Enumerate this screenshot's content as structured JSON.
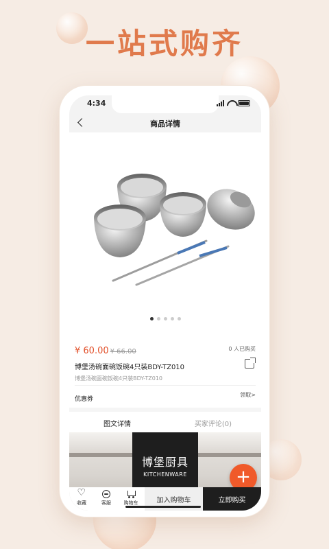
{
  "hero": {
    "title": "一站式购齐"
  },
  "status": {
    "time": "4:34"
  },
  "nav": {
    "title": "商品详情"
  },
  "carousel": {
    "count": 5,
    "active_index": 0
  },
  "product": {
    "price": "¥ 60.00",
    "original_price": "¥ 66.00",
    "buyers": "0 人已购买",
    "name": "博堡汤碗面碗饭碗4只装BDY-TZ010",
    "subtitle": "博堡汤碗面碗饭碗4只装BDY-TZ010"
  },
  "coupon": {
    "label": "优惠券",
    "action": "领取>"
  },
  "tabs": [
    {
      "label": "图文详情",
      "active": true
    },
    {
      "label": "买家评论(0)",
      "active": false
    }
  ],
  "banner": {
    "brand_cn": "博堡厨具",
    "brand_en": "KITCHENWARE"
  },
  "fab": {
    "label": "+"
  },
  "bottom_bar": {
    "favorite": "收藏",
    "service": "客服",
    "cart": "购物车",
    "add_to_cart": "加入购物车",
    "buy_now": "立即购买"
  },
  "colors": {
    "accent": "#e07a4c",
    "price": "#e2502a",
    "fab": "#f05a2a",
    "dark": "#1e1e1e"
  }
}
